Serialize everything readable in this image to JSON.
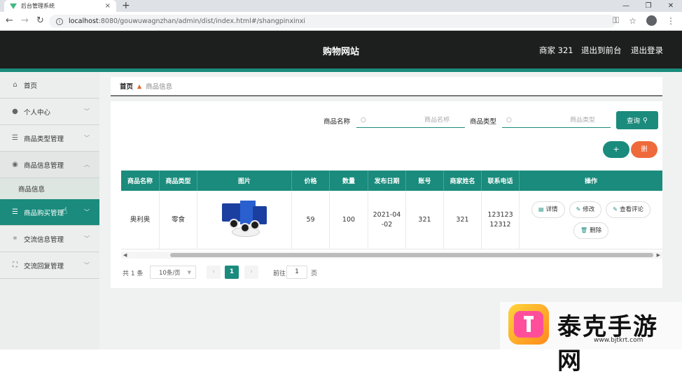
{
  "browser": {
    "tab_title": "后台管理系统",
    "url_host": "localhost",
    "url_rest": ":8080/gouwuwagnzhan/admin/dist/index.html#/shangpinxinxi"
  },
  "header": {
    "title": "购物网站",
    "user": "商家 321",
    "back_to_front": "退出到前台",
    "logout": "退出登录"
  },
  "sidebar": {
    "items": [
      {
        "label": "首页",
        "icon": "home-icon"
      },
      {
        "label": "个人中心",
        "icon": "user-icon"
      },
      {
        "label": "商品类型管理",
        "icon": "list-icon"
      },
      {
        "label": "商品信息管理",
        "icon": "location-icon"
      },
      {
        "label": "商品信息"
      },
      {
        "label": "商品购买管理",
        "icon": "list-icon"
      },
      {
        "label": "交流信息管理",
        "icon": "crop-icon"
      },
      {
        "label": "交流回复管理",
        "icon": "fullscreen-icon"
      }
    ]
  },
  "breadcrumb": {
    "home": "首页",
    "current": "商品信息"
  },
  "search": {
    "name_label": "商品名称",
    "name_placeholder": "商品名称",
    "type_label": "商品类型",
    "type_placeholder": "商品类型",
    "query_button": "查询"
  },
  "actions": {
    "add": "+",
    "delete": "删"
  },
  "table": {
    "headers": [
      "商品名称",
      "商品类型",
      "图片",
      "价格",
      "数量",
      "发布日期",
      "账号",
      "商家姓名",
      "联系电话",
      "操作"
    ],
    "rows": [
      {
        "name": "奥利奥",
        "type": "零食",
        "price": "59",
        "quantity": "100",
        "date": "2021-04-02",
        "account": "321",
        "merchant": "321",
        "phone": "12312312312"
      }
    ],
    "ops": {
      "detail": "详情",
      "edit": "修改",
      "reviews": "查看评论",
      "delete": "删除"
    }
  },
  "pagination": {
    "total": "共 1 条",
    "page_size": "10条/页",
    "current": "1",
    "goto_label": "前往",
    "goto_value": "1",
    "page_suffix": "页"
  },
  "watermark": {
    "text": "泰克手游网",
    "url": "www.bjtkrt.com"
  },
  "colors": {
    "accent": "#1a8b7c",
    "danger": "#ef6a3b",
    "header_bg": "#1d1e1e"
  }
}
